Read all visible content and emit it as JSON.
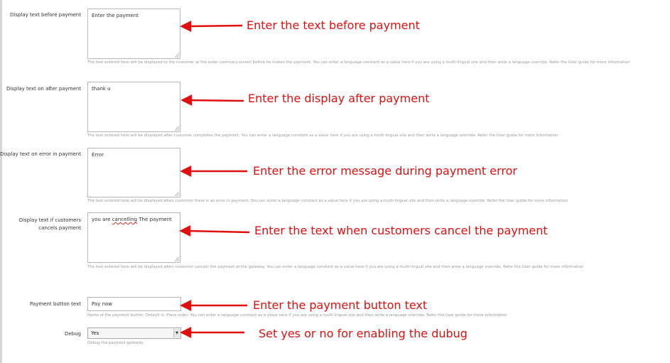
{
  "fields": [
    {
      "label": "Display text before payment",
      "value": "Enter the payment",
      "help": "The text entered here will be displayed to the customer at the order summary screen before he makes the payment. You can enter a language constant as a value here if you are using a multi-lingual site and then write a language override. Refer the User guide for more information",
      "annotation": "Enter the text before payment"
    },
    {
      "label": "Display text on after payment",
      "value": "thank u",
      "help": "The text entered here will be displayed after customer completes the payment. You can enter a language constant as a value here if you are using a multi-lingual site and then write a language override. Refer the User guide for more information",
      "annotation": "Enter the display after payment"
    },
    {
      "label": "Display text on error in payment",
      "value": "Error",
      "help": "The text entered here will be displayed when customer there is an error in payment. You can enter a language constant as a value here if you are using a multi-lingual site and then write a language override. Refer the User guide for more information",
      "annotation": "Enter the error message during payment error"
    },
    {
      "label": "Display text if customers cancels payment",
      "value_plain_1": "you are ",
      "value_spell": "cancelling",
      "value_plain_2": " The payment",
      "help": "The text entered here will be displayed when customer cancels the payment at the gateway. You can enter a language constant as a value here if you are using a multi-lingual site and then write a language override. Refer the User guide for more information",
      "annotation": "Enter the text when customers cancel the payment"
    },
    {
      "label": "Payment button text",
      "value": "Pay now",
      "help": "Name of the payment button. Default is: Place order. You can enter a language constant as a value here if you are using a multi-lingual site and then write a language override. Refer the User guide for more information",
      "annotation": "Enter the payment button text"
    },
    {
      "label": "Debug",
      "selected": "Yes",
      "help": "Debug the payment gateway",
      "annotation": "Set yes or no for enabling the dubug"
    }
  ],
  "colors": {
    "annotation": "#e01010",
    "help_text": "#9a9a9a",
    "border": "#b7b7b7"
  },
  "icons": {
    "select_arrow": "chevron-down-icon",
    "arrow": "arrow-left-icon"
  }
}
